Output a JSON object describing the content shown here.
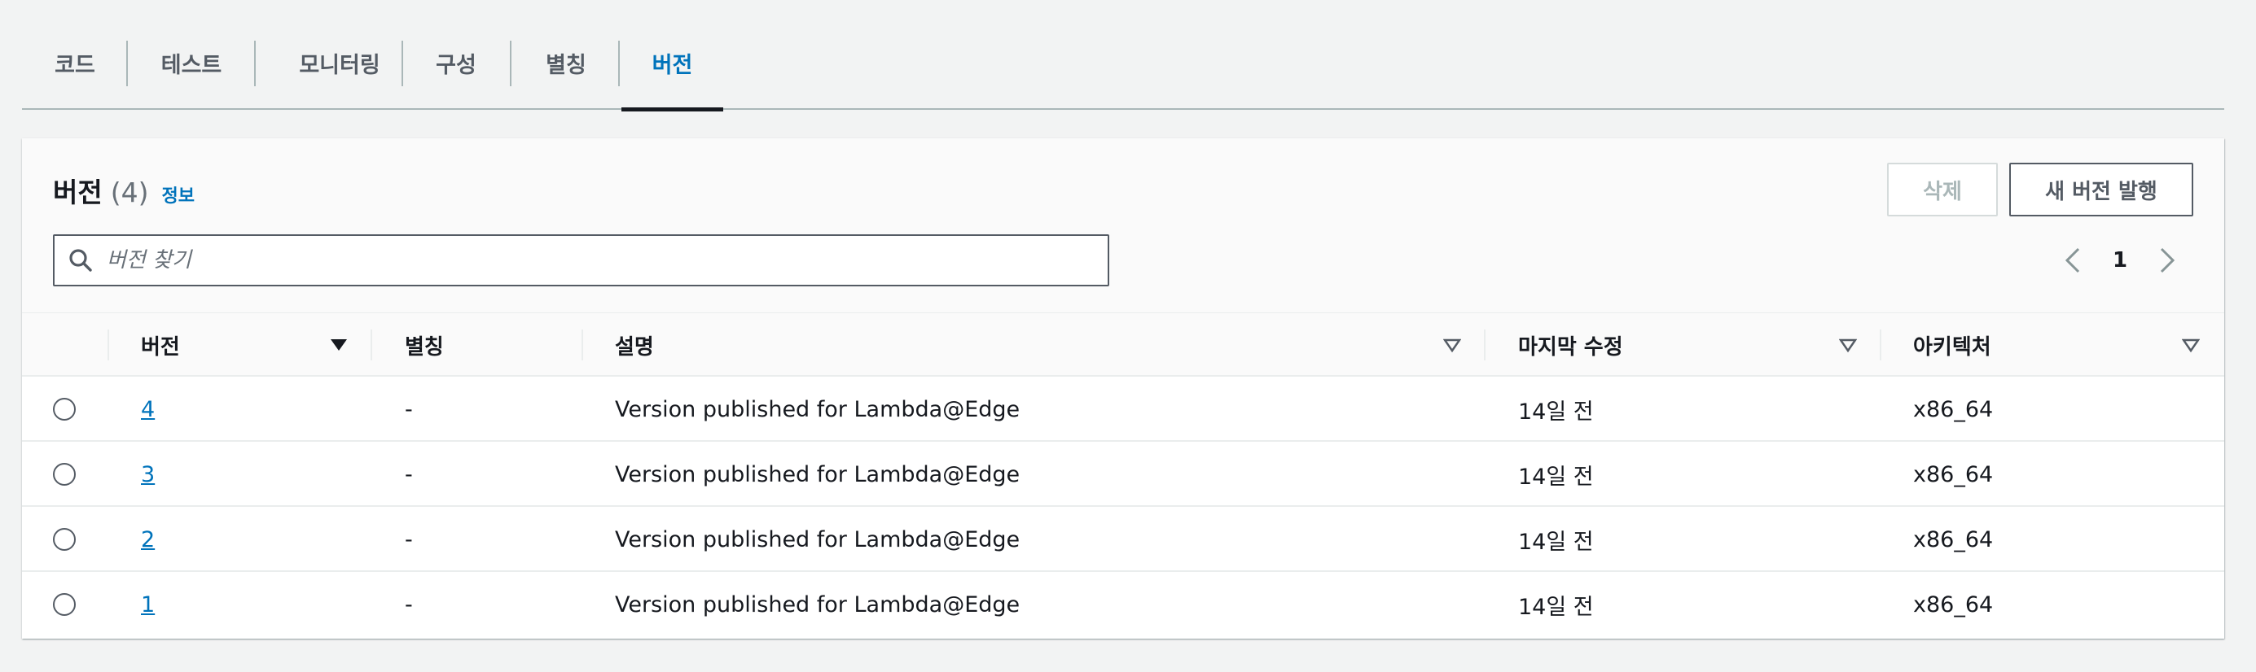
{
  "tabs": [
    {
      "label": "코드",
      "active": false
    },
    {
      "label": "테스트",
      "active": false
    },
    {
      "label": "모니터링",
      "active": false
    },
    {
      "label": "구성",
      "active": false
    },
    {
      "label": "별칭",
      "active": false
    },
    {
      "label": "버전",
      "active": true
    }
  ],
  "panel": {
    "title": "버전",
    "count": "(4)",
    "info_link": "정보",
    "delete_button": "삭제",
    "publish_button": "새 버전 발행",
    "search": {
      "value": "",
      "placeholder": "버전 찾기"
    },
    "pagination": {
      "current_page": "1"
    }
  },
  "table": {
    "columns": {
      "version": "버전",
      "alias": "별칭",
      "description": "설명",
      "last_modified": "마지막 수정",
      "architecture": "아키텍처"
    },
    "rows": [
      {
        "version": "4",
        "alias": "-",
        "description": "Version published for Lambda@Edge",
        "last_modified": "14일 전",
        "architecture": "x86_64"
      },
      {
        "version": "3",
        "alias": "-",
        "description": "Version published for Lambda@Edge",
        "last_modified": "14일 전",
        "architecture": "x86_64"
      },
      {
        "version": "2",
        "alias": "-",
        "description": "Version published for Lambda@Edge",
        "last_modified": "14일 전",
        "architecture": "x86_64"
      },
      {
        "version": "1",
        "alias": "-",
        "description": "Version published for Lambda@Edge",
        "last_modified": "14일 전",
        "architecture": "x86_64"
      }
    ]
  },
  "colors": {
    "link": "#0073bb",
    "text": "#16191f",
    "background": "#f2f3f3",
    "border": "#aab7b8"
  },
  "icons": {
    "search": "search-icon",
    "prev": "chevron-left-icon",
    "next": "chevron-right-icon",
    "sort_active": "sort-descending-icon",
    "sort_inactive": "sort-icon"
  }
}
